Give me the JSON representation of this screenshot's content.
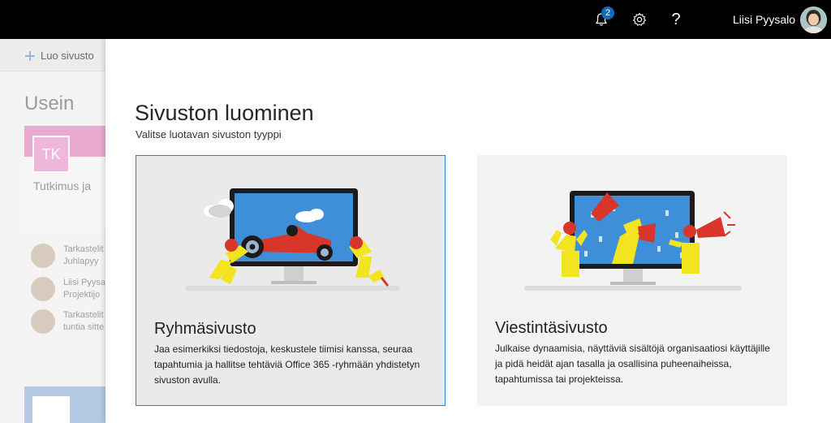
{
  "topbar": {
    "notification_count": "2",
    "help_glyph": "?",
    "user_name": "Liisi Pyysalo",
    "icons": [
      "bell-icon",
      "gear-icon",
      "help-icon"
    ]
  },
  "background": {
    "create_site_label": "Luo sivusto",
    "frequent_title": "Usein",
    "site_card": {
      "initials": "TK",
      "name": "Tutkimus ja"
    },
    "activity": [
      {
        "line1": "Tarkastelit",
        "line2": "Juhlapyy"
      },
      {
        "line1": "Liisi Pyysa",
        "line2": "Projektijo"
      },
      {
        "line1": "Tarkastelit",
        "line2": "tuntia sitte"
      }
    ]
  },
  "panel": {
    "title": "Sivuston luominen",
    "subtitle": "Valitse luotavan sivuston tyyppi",
    "options": [
      {
        "title": "Ryhmäsivusto",
        "description": "Jaa esimerkiksi tiedostoja, keskustele tiimisi kanssa, seuraa tapahtumia ja hallitse tehtäviä Office 365 -ryhmään yhdistetyn sivuston avulla.",
        "selected": true
      },
      {
        "title": "Viestintäsivusto",
        "description": "Julkaise dynaamisia, näyttäviä sisältöjä organisaatiosi käyttäjille ja pidä heidät ajan tasalla ja osallisina puheenaiheissa, tapahtumissa tai projekteissa.",
        "selected": false
      }
    ]
  },
  "colors": {
    "accent": "#2c7dd1",
    "topbar": "#000000",
    "badge": "#0f6cbd",
    "figure_yellow": "#f2e41e",
    "figure_red": "#d9362b",
    "screen_blue": "#3f8fd8"
  }
}
